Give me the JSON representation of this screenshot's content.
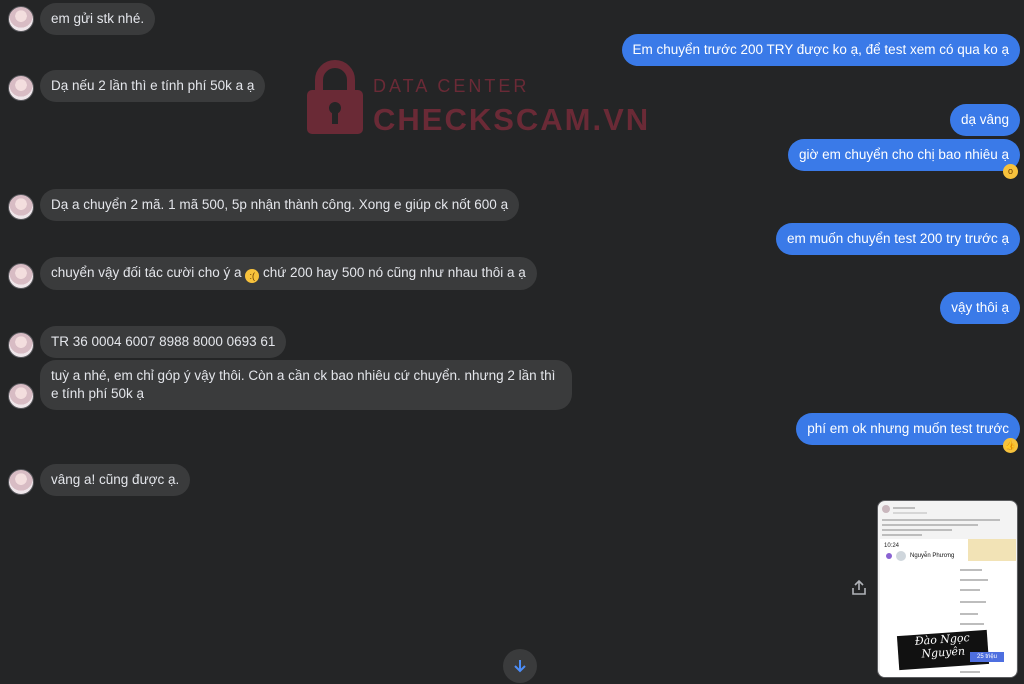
{
  "watermark": {
    "top": "DATA CENTER",
    "main": "CHECKSCAM.VN"
  },
  "messages": {
    "m1": "em gửi stk nhé.",
    "m2": "Em chuyển trước 200 TRY được ko ạ, để test xem có qua ko ạ",
    "m3": "Dạ nếu 2 lần thì e tính phí 50k a ạ",
    "m4": "dạ vâng",
    "m5": "giờ em chuyển cho chị bao nhiêu ạ",
    "m6": "Dạ a chuyển 2 mã. 1 mã 500, 5p nhận thành công. Xong e giúp ck nốt 600 ạ",
    "m7": "em muốn chuyển test 200 try trước ạ",
    "m8a": "chuyển vậy đối tác cười cho ý a",
    "m8b": "chứ 200 hay 500 nó cũng như nhau thôi a ạ",
    "m9": "vậy thôi ạ",
    "m10": "TR 36 0004 6007 8988 8000 0693 61",
    "m11": "tuỳ a nhé, em chỉ góp ý vậy thôi. Còn a cần ck bao nhiêu cứ chuyển. nhưng 2 lần thì e tính phí 50k ạ",
    "m12": "phí em ok nhưng muốn test trước",
    "m13": "vâng a! cũng được ạ."
  },
  "attachment": {
    "name": "Nguyễn Phương",
    "time": "10:24",
    "signature": "Đào Ngọc Nguyên",
    "amount": "25 triệu"
  },
  "icons": {
    "react1": "surprised-emoji",
    "react2": "thumbs-up-emoji",
    "inline": "sad-emoji",
    "share": "share-icon",
    "scroll": "arrow-down-icon"
  }
}
